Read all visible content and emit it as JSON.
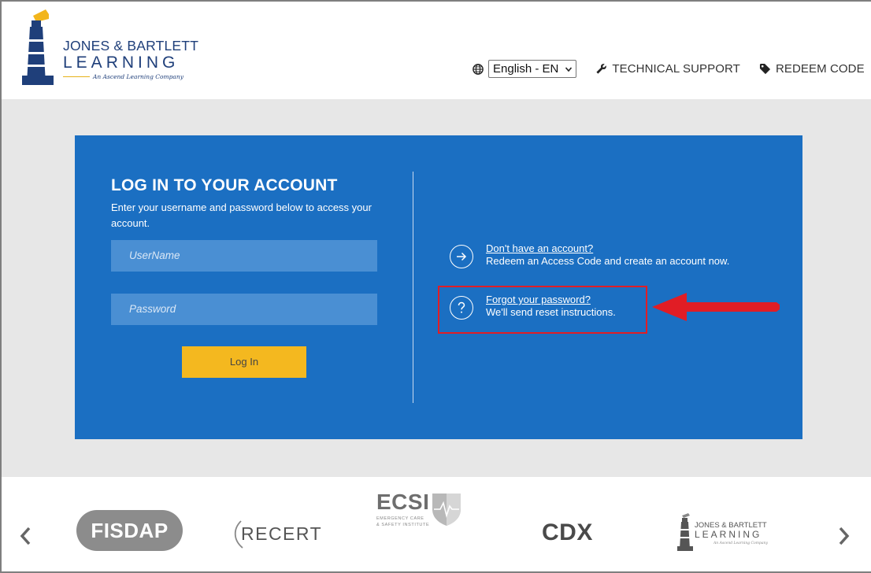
{
  "header": {
    "logo": {
      "line1": "JONES & BARTLETT",
      "line2": "LEARNING",
      "tagline": "An Ascend Learning Company"
    },
    "language": {
      "selected": "English - EN"
    },
    "links": {
      "support": "TECHNICAL SUPPORT",
      "redeem": "REDEEM CODE"
    }
  },
  "login": {
    "title": "LOG IN TO YOUR ACCOUNT",
    "subtitle": "Enter your username and password below to access your account.",
    "username_placeholder": "UserName",
    "password_placeholder": "Password",
    "button": "Log In"
  },
  "side": {
    "account_link": "Don't have an account?",
    "account_desc": "Redeem an Access Code and create an account now.",
    "forgot_link": "Forgot your password?",
    "forgot_desc": "We'll send reset instructions."
  },
  "annotation": {
    "color": "#e11d25"
  },
  "colors": {
    "panel": "#1b6fc2",
    "button": "#f4b81f",
    "field": "#4a8fd3"
  },
  "brands": {
    "fisdap": "FISDAP",
    "recert": "RECERT",
    "ecsi": "ECSI",
    "ecsi_sub_1": "EMERGENCY CARE",
    "ecsi_sub_2": "& SAFETY INSTITUTE",
    "cdx": "CDX",
    "jb_line1": "JONES & BARTLETT",
    "jb_line2": "LEARNING",
    "jb_tag": "An Ascend Learning Company"
  },
  "icons": {
    "globe": "globe-icon",
    "wrench": "wrench-icon",
    "tag": "tag-icon",
    "arrow_circle": "arrow-right-circle-icon",
    "question_circle": "question-circle-icon",
    "prev": "chevron-left-icon",
    "next": "chevron-right-icon"
  }
}
